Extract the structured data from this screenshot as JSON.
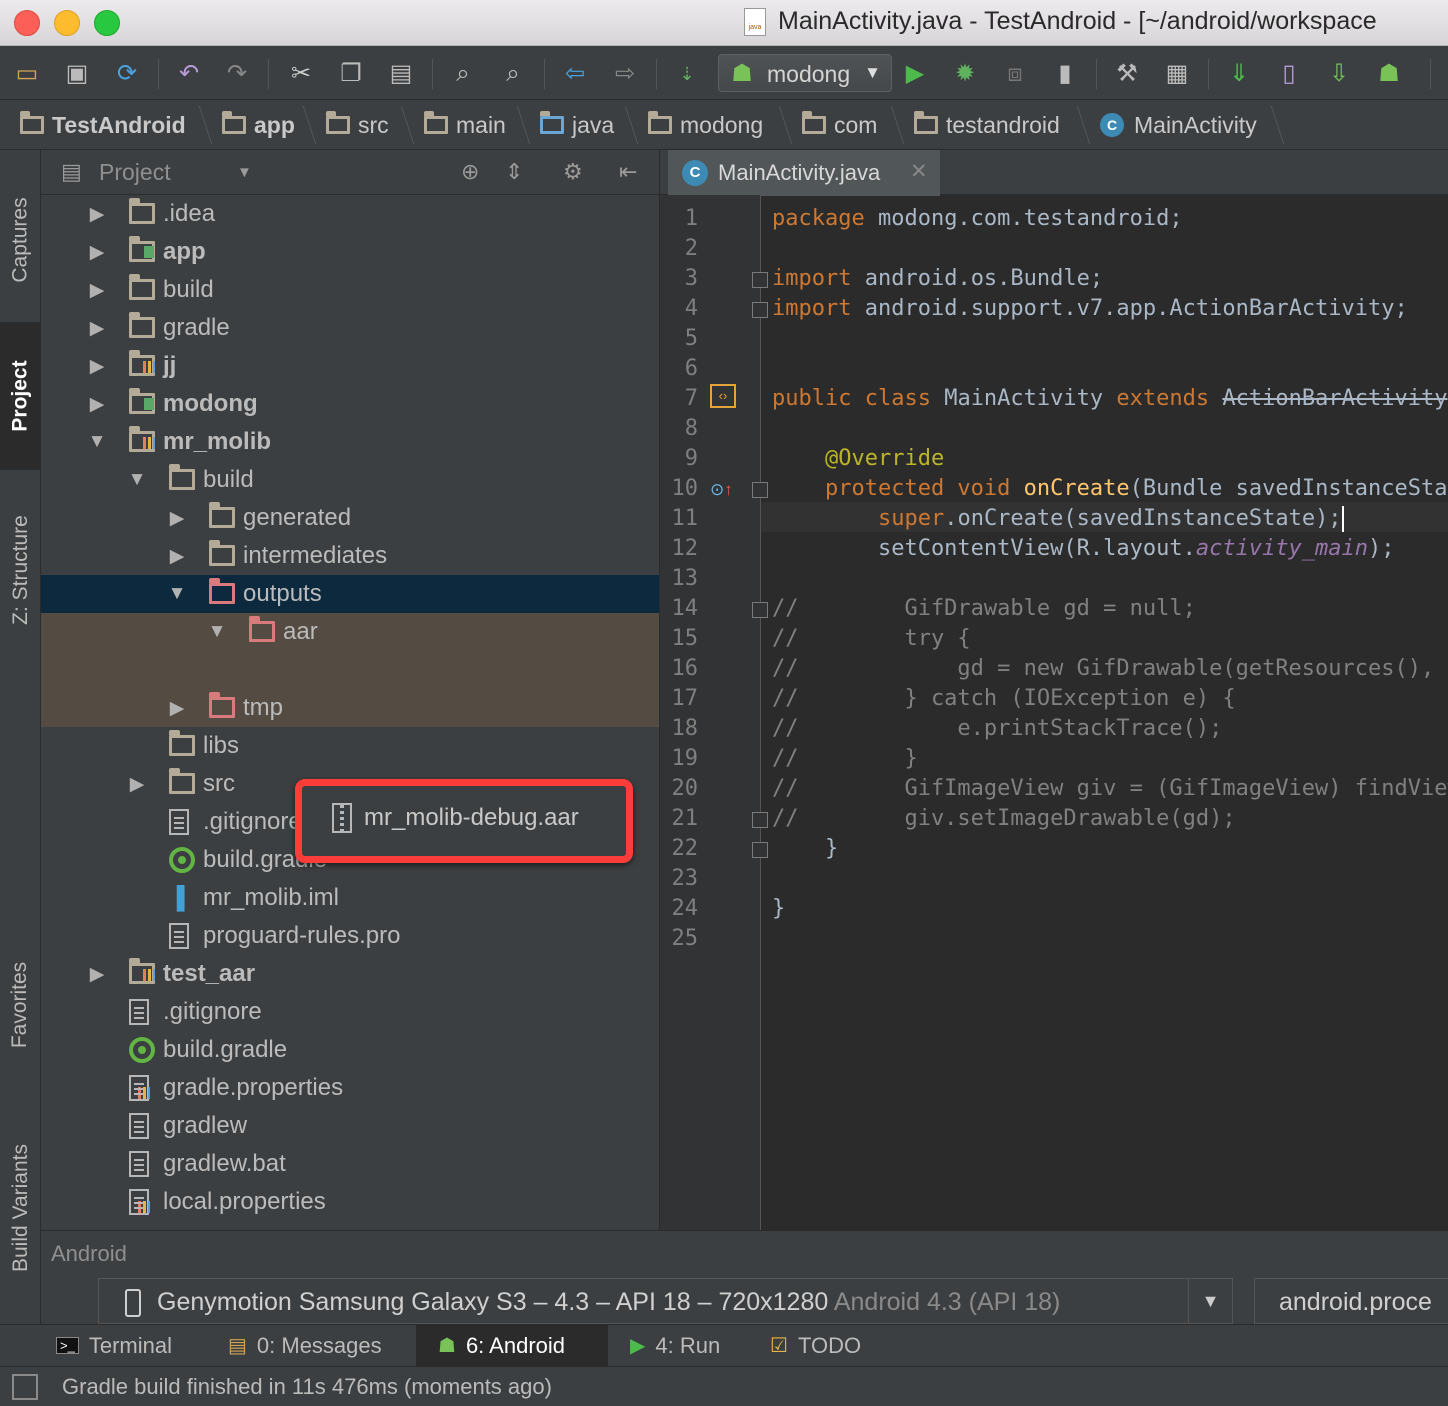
{
  "window": {
    "title": "MainActivity.java - TestAndroid - [~/android/workspace",
    "title_icon_label": "java"
  },
  "toolbar": {
    "run_config": "modong",
    "icons": [
      "open-folder-icon",
      "save-icon",
      "sync-icon",
      "undo-icon",
      "redo-icon",
      "cut-icon",
      "copy-icon",
      "paste-icon",
      "find-icon",
      "replace-icon",
      "back-icon",
      "forward-icon",
      "make-project-icon",
      "android-icon",
      "run-icon",
      "debug-icon",
      "attach-debugger-icon",
      "stop-icon",
      "sdk-tools-icon",
      "project-structure-icon",
      "sync-gradle-icon",
      "avd-manager-icon",
      "sdk-manager-icon",
      "android-monitor-icon"
    ]
  },
  "breadcrumbs": [
    "TestAndroid",
    "app",
    "src",
    "main",
    "java",
    "modong",
    "com",
    "testandroid",
    "MainActivity"
  ],
  "left_tool_tabs": [
    {
      "label": "Captures"
    },
    {
      "label": "Project"
    },
    {
      "label": "Z: Structure"
    },
    {
      "label": "Favorites"
    },
    {
      "label": "Build Variants"
    }
  ],
  "project_panel": {
    "title": "Project",
    "rows": [
      {
        "label": ".idea",
        "kind": "folder",
        "twisty": "▶"
      },
      {
        "label": "app",
        "kind": "module",
        "twisty": "▶"
      },
      {
        "label": "build",
        "kind": "folder",
        "twisty": "▶"
      },
      {
        "label": "gradle",
        "kind": "folder",
        "twisty": "▶"
      },
      {
        "label": "jj",
        "kind": "lib",
        "twisty": "▶"
      },
      {
        "label": "modong",
        "kind": "module",
        "twisty": "▶"
      },
      {
        "label": "mr_molib",
        "kind": "lib",
        "twisty": "▼"
      },
      {
        "label": "build",
        "kind": "folder",
        "twisty": "▼"
      },
      {
        "label": "generated",
        "kind": "folder",
        "twisty": "▶"
      },
      {
        "label": "intermediates",
        "kind": "folder",
        "twisty": "▶"
      },
      {
        "label": "outputs",
        "kind": "folder-red",
        "twisty": "▼"
      },
      {
        "label": "aar",
        "kind": "folder-red",
        "twisty": "▼"
      },
      {
        "label": "",
        "kind": "none",
        "twisty": ""
      },
      {
        "label": "tmp",
        "kind": "folder-red",
        "twisty": "▶"
      },
      {
        "label": "libs",
        "kind": "folder",
        "twisty": ""
      },
      {
        "label": "src",
        "kind": "folder",
        "twisty": "▶"
      },
      {
        "label": ".gitignore",
        "kind": "file",
        "twisty": ""
      },
      {
        "label": "build.gradle",
        "kind": "gradle",
        "twisty": ""
      },
      {
        "label": "mr_molib.iml",
        "kind": "iml",
        "twisty": ""
      },
      {
        "label": "proguard-rules.pro",
        "kind": "file",
        "twisty": ""
      },
      {
        "label": "test_aar",
        "kind": "lib",
        "twisty": "▶"
      },
      {
        "label": ".gitignore",
        "kind": "file",
        "twisty": ""
      },
      {
        "label": "build.gradle",
        "kind": "gradle",
        "twisty": ""
      },
      {
        "label": "gradle.properties",
        "kind": "props",
        "twisty": ""
      },
      {
        "label": "gradlew",
        "kind": "file",
        "twisty": ""
      },
      {
        "label": "gradlew.bat",
        "kind": "file",
        "twisty": ""
      },
      {
        "label": "local.properties",
        "kind": "props",
        "twisty": ""
      }
    ],
    "highlighted_file": "mr_molib-debug.aar"
  },
  "editor": {
    "tab_label": "MainActivity.java",
    "line_numbers": [
      "1",
      "2",
      "3",
      "4",
      "5",
      "6",
      "7",
      "8",
      "9",
      "10",
      "11",
      "12",
      "13",
      "14",
      "15",
      "16",
      "17",
      "18",
      "19",
      "20",
      "21",
      "22",
      "23",
      "24",
      "25"
    ]
  },
  "android_panel": {
    "title": "Android",
    "device_name": "Genymotion Samsung Galaxy S3 – 4.3 – API 18 – 720x1280",
    "device_os": "Android 4.3 (API 18)",
    "process": "android.proce"
  },
  "bottom_tabs": [
    {
      "label": "Terminal"
    },
    {
      "label": "0: Messages"
    },
    {
      "label": "6: Android"
    },
    {
      "label": "4: Run"
    },
    {
      "label": "TODO"
    }
  ],
  "status": {
    "message": "Gradle build finished in 11s 476ms (moments ago)"
  }
}
